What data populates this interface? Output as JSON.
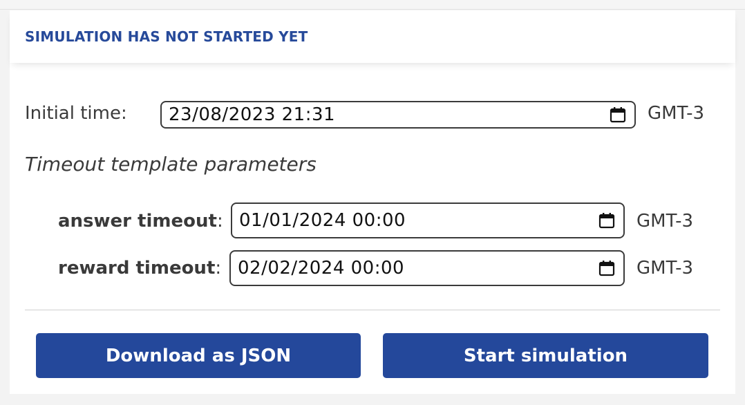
{
  "status": {
    "title": "SIMULATION HAS NOT STARTED YET"
  },
  "initial_time": {
    "label": "Initial time:",
    "value": "23/08/2023 21:31",
    "timezone": "GMT-3"
  },
  "timeout_section": {
    "heading": "Timeout template parameters",
    "answer_timeout": {
      "label": "answer timeout",
      "colon": ":",
      "value": "01/01/2024 00:00",
      "timezone": "GMT-3"
    },
    "reward_timeout": {
      "label": "reward timeout",
      "colon": ":",
      "value": "02/02/2024 00:00",
      "timezone": "GMT-3"
    }
  },
  "actions": {
    "download_label": "Download as JSON",
    "start_label": "Start simulation"
  },
  "icons": {
    "calendar": "calendar-icon"
  },
  "colors": {
    "accent": "#24489b",
    "title": "#274a9a",
    "text": "#3a3a3a"
  }
}
